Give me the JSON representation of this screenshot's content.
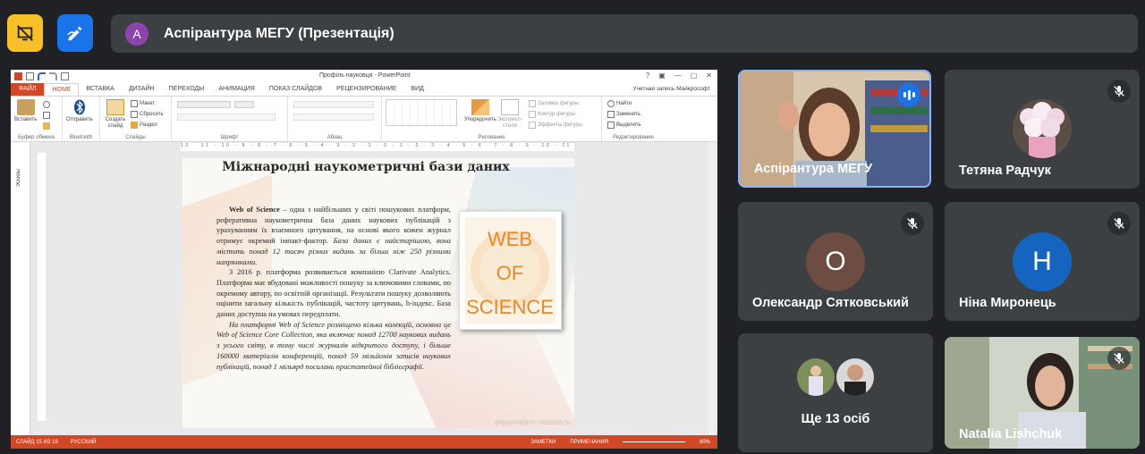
{
  "meeting": {
    "title": "Аспірантура МЕГУ (Презентація)",
    "title_avatar_letter": "А",
    "title_avatar_color": "#8e44ad"
  },
  "powerpoint": {
    "window_title": "Профіль науковця - PowerPoint",
    "window_controls": [
      "?",
      "▣",
      "—",
      "▢",
      "✕"
    ],
    "tabs": [
      "ФАЙЛ",
      "HOME",
      "ВСТАВКА",
      "ДИЗАЙН",
      "ПЕРЕХОДЫ",
      "АНИМАЦИЯ",
      "ПОКАЗ СЛАЙДОВ",
      "РЕЦЕНЗИРОВАНИЕ",
      "ВИД"
    ],
    "active_tab": "HOME",
    "account": "Учетная запись Майкрософт",
    "ribbon": {
      "clipboard_group": "Буфер обмена",
      "paste": "Вставить",
      "bluetooth_group": "Bluetooth",
      "send": "Отправить",
      "slides_group": "Слайды",
      "new_slide": "Создать слайд",
      "layout": "Макет",
      "reset": "Сбросить",
      "section": "Раздел",
      "font_group": "Шрифт",
      "paragraph_group": "Абзац",
      "drawing_group": "Рисование",
      "arrange": "Упорядочить",
      "quick_styles": "Экспресс-стили",
      "shape_fill": "Заливка фигуры",
      "shape_outline": "Контур фигуры",
      "shape_effects": "Эффекты фигуры",
      "editing_group": "Редактирование",
      "find": "Найти",
      "replace": "Заменить",
      "select": "Выделить"
    },
    "ruler_text": "12 · 11 · 10 · 9 · 8 · 7 · 6 · 5 · 4 · 3 · 2 · 1 · 0 · 1 · 2 · 3 · 4 · 5 · 6 · 7 · 8 · 9 · 10 · 11 · 12",
    "thumbnails_label": "Эскизы",
    "status": {
      "slide": "СЛАЙД 15 ИЗ 18",
      "language": "РУССКИЙ",
      "notes": "ЗАМЕТКИ",
      "comments": "ПРИМЕЧАНИЯ",
      "zoom": "80%"
    },
    "slide": {
      "title": "Міжнародні наукометричні бази даних",
      "p1_bold": "Web of Science",
      "p1_text": " – одна з найбільших у світі пошукових платформ, реферативна наукометрична база даних наукових публікацій з урахуванням їх взаємного цитування, на основі якого кожен журнал отримує окремий імпакт-фактор. ",
      "p1_italic": "База даних є найстарішою, вона містить понад 12 тисяч різних видань за більш ніж 250 різними напрямками.",
      "p2": "З 2016 р. платформа розвивається компанією Clarivate Analytics. Платформа має вбудовані можливості пошуку за ключовими словами, по окремому автору, по освітній організації. Результати пошуку дозволяють оцінити загальну кількість публікацій, частоту цитувань, h-індекс. База даних доступна на умовах передплати.",
      "p3": "На платформі Web of Science розміщено кілька колекцій, основна це Web of Science Core Collection, яка включає понад 12700 наукових видань з усього світу, в тому числі журналів відкритого доступу, і більше 160000 матеріалів конференцій, понад 59 мільйонів записів наукових публікацій, понад 1 мільярд посилань пристатейної бібліографії.",
      "logo_lines": [
        "WEB",
        "OF",
        "SCIENCE"
      ],
      "watermark": "presentation-creation.ru"
    }
  },
  "participants": [
    {
      "name": "Аспірантура МЕГУ",
      "speaking": true
    },
    {
      "name": "Тетяна Радчук",
      "muted": true
    },
    {
      "name": "Олександр Сятковський",
      "initial": "О",
      "color": "#6d4c41",
      "muted": true
    },
    {
      "name": "Ніна Миронець",
      "initial": "Н",
      "color": "#1565c0",
      "muted": true
    },
    {
      "name": "Ще 13 осіб"
    },
    {
      "name": "Natalia Lishchuk",
      "muted": true
    }
  ],
  "colors": {
    "yellow_button": "#f6c026",
    "blue_button": "#1a73e8",
    "powerpoint_accent": "#d24726",
    "speaking_border": "#8ab4f8"
  }
}
